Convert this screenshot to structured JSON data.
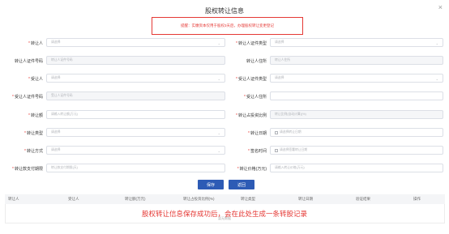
{
  "dialog": {
    "title": "股权转让信息",
    "close_label": "×"
  },
  "notice": "提醒：实缴资本仅用于股权3天后，办理股权转让变更登记",
  "form": {
    "transferor": {
      "label": "转让人",
      "placeholder": "请选择",
      "required": true
    },
    "transferor_id_type": {
      "label": "转让人证件类型",
      "placeholder": "请选择",
      "required": true
    },
    "transferor_id_no": {
      "label": "转让人证件号码",
      "placeholder": "转让人证件号码"
    },
    "transferor_address": {
      "label": "转让人住所",
      "placeholder": "转让人住所"
    },
    "transferee": {
      "label": "受让人",
      "placeholder": "请选择",
      "required": true
    },
    "transferee_id_type": {
      "label": "受让人证件类型",
      "placeholder": "请选择",
      "required": true
    },
    "transferee_id_no": {
      "label": "受让人证件号码",
      "placeholder": "受让人证件号码",
      "required": true
    },
    "transferee_address": {
      "label": "受让人住所",
      "placeholder": "",
      "required": true
    },
    "transfer_amount": {
      "label": "转让额",
      "placeholder": "请输入转让额(万元)",
      "required": true
    },
    "transfer_ratio": {
      "label": "转让占投资比例",
      "placeholder": "转让比例(自动计算)(%)",
      "required": true
    },
    "transfer_type": {
      "label": "转让类型",
      "placeholder": "请选择",
      "required": true
    },
    "transfer_date": {
      "label": "转让日期",
      "placeholder": "请选择转让日期",
      "required": true
    },
    "transfer_method": {
      "label": "转让方式",
      "placeholder": "请选择",
      "required": true
    },
    "sign_time": {
      "label": "签名时间",
      "placeholder": "请选择签署转让日期",
      "required": true
    },
    "payment_deadline": {
      "label": "转让款支付期限",
      "placeholder": "转让款支付期限(天)",
      "required": true
    },
    "transfer_price": {
      "label": "转让价格(万元)",
      "placeholder": "请输入转让价格(万元)",
      "required": true
    }
  },
  "actions": {
    "save": "保存",
    "back": "返回"
  },
  "table": {
    "columns": [
      "转让人",
      "受让人",
      "转让额(万元)",
      "转让占投资比例(%)",
      "转让类型",
      "转让日期",
      "验证结果",
      "操作"
    ],
    "empty_text": "暂无数据"
  },
  "overlay_note": "股权转让信息保存成功后，会在此处生成一条转股记录",
  "colors": {
    "accent": "#2d5bb5",
    "alert": "#e53935"
  },
  "icons": {
    "close": "close-icon",
    "dropdown": "chevron-down-icon",
    "date": "calendar-icon"
  }
}
